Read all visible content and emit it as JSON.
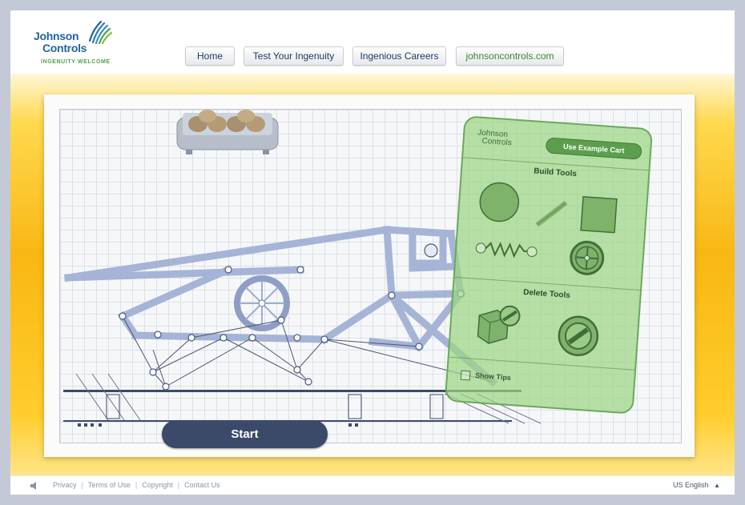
{
  "brand": {
    "name_line1": "Johnson",
    "name_line2": "Controls",
    "tagline": "INGENUITY WELCOME"
  },
  "nav": {
    "items": [
      {
        "label": "Home"
      },
      {
        "label": "Test Your Ingenuity"
      },
      {
        "label": "Ingenious Careers"
      },
      {
        "label": "johnsoncontrols.com"
      }
    ]
  },
  "game": {
    "start_label": "Start",
    "panel": {
      "logo_line1": "Johnson",
      "logo_line2": "Controls",
      "example_button": "Use Example Cart",
      "build_tools_title": "Build Tools",
      "build_tools": [
        "circle",
        "rod",
        "square",
        "spring",
        "wheel"
      ],
      "delete_tools_title": "Delete Tools",
      "delete_tools": [
        "delete-shape",
        "delete-joint"
      ],
      "show_tips_label": "Show Tips",
      "show_tips_checked": false
    }
  },
  "footer": {
    "links": [
      "Privacy",
      "Terms of Use",
      "Copyright",
      "Contact Us"
    ],
    "language": "US English"
  },
  "colors": {
    "brand_blue": "#1f66a6",
    "brand_green": "#4ba545",
    "start_button": "#3b4a6b",
    "panel_green": "#9bd582",
    "stage_yellow": "#f9b713"
  }
}
